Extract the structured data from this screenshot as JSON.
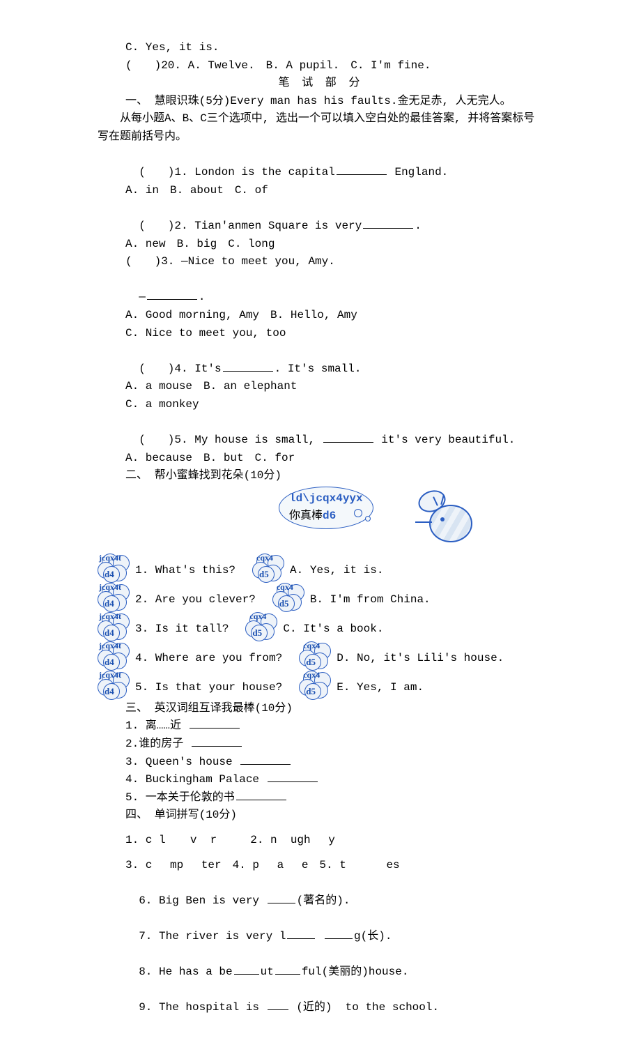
{
  "top": {
    "l1": "C. Yes, it is.",
    "l2": "(　　)20. A. Twelve.　B. A pupil.　C. I'm fine."
  },
  "written_header": "笔 试 部 分",
  "sec1": {
    "title": "一、 慧眼识珠(5分)Every man has his faults.金无足赤, 人无完人。",
    "instr": "　　从每小题A、B、C三个选项中, 选出一个可以填入空白处的最佳答案, 并将答案标号写在题前括号内。",
    "q1a": "(　　)1. London is the capital",
    "q1b": " England.",
    "q1opt": "A. in　B. about　C. of",
    "q2a": "(　　)2. Tian'anmen Square is very",
    "q2b": ".",
    "q2opt": "A. new　B. big　C. long",
    "q3": "(　　)3. —Nice to meet you, Amy.",
    "q3b": "—",
    "q3c": ".",
    "q3opt1": "A. Good morning, Amy　B. Hello, Amy",
    "q3opt2": "C. Nice to meet you, too",
    "q4a": "(　　)4. It's",
    "q4b": ". It's small.",
    "q4opt1": "A. a mouse　B. an elephant",
    "q4opt2": "C. a monkey",
    "q5a": "(　　)5. My house is small, ",
    "q5b": " it's very beautiful.",
    "q5opt": "A. because　B. but　C. for"
  },
  "sec2": {
    "title": "二、 帮小蜜蜂找到花朵(10分)",
    "bubble_top": "ld\\jcqx4yyx",
    "bubble_cn": "你真棒",
    "bubble_suffix": "d6",
    "left_label": "jcqx4t",
    "left_sub": "d4",
    "right_label": "cqx4",
    "right_sub": "d5",
    "q1": "1. What's this?",
    "a1": "A. Yes, it is.",
    "q2": "2. Are you clever?",
    "a2": "B. I'm from China.",
    "q3": "3. Is it tall?",
    "a3": "C. It's a book.",
    "q4": "4. Where are you from?",
    "a4": "D. No, it's Lili's house.",
    "q5": "5. Is that your house?",
    "a5": "E. Yes, I am."
  },
  "sec3": {
    "title": "三、 英汉词组互译我最棒(10分)",
    "l1": "1. 离……近 ",
    "l2": "2.谁的房子 ",
    "l3": "3. Queen's house ",
    "l4": "4. Buckingham Palace ",
    "l5": "5. 一本关于伦敦的书"
  },
  "sec4": {
    "title": "四、 单词拼写(10分)",
    "l1": "1. c l 　 v  r　　　2. n  ugh 　y",
    "l2": "3. c 　mp 　ter　4. p 　a 　e　5. t 　　　es",
    "l3a": "6. Big Ben is very ",
    "l3b": "(著名的).",
    "l4a": "7. The river is very l",
    "l4b": "g(长).",
    "l5a": "8. He has a be",
    "l5b": "ut",
    "l5c": "ful(美丽的)house.",
    "l6a": "9. The hospital is ",
    "l6b": " (近的)  to the school."
  }
}
